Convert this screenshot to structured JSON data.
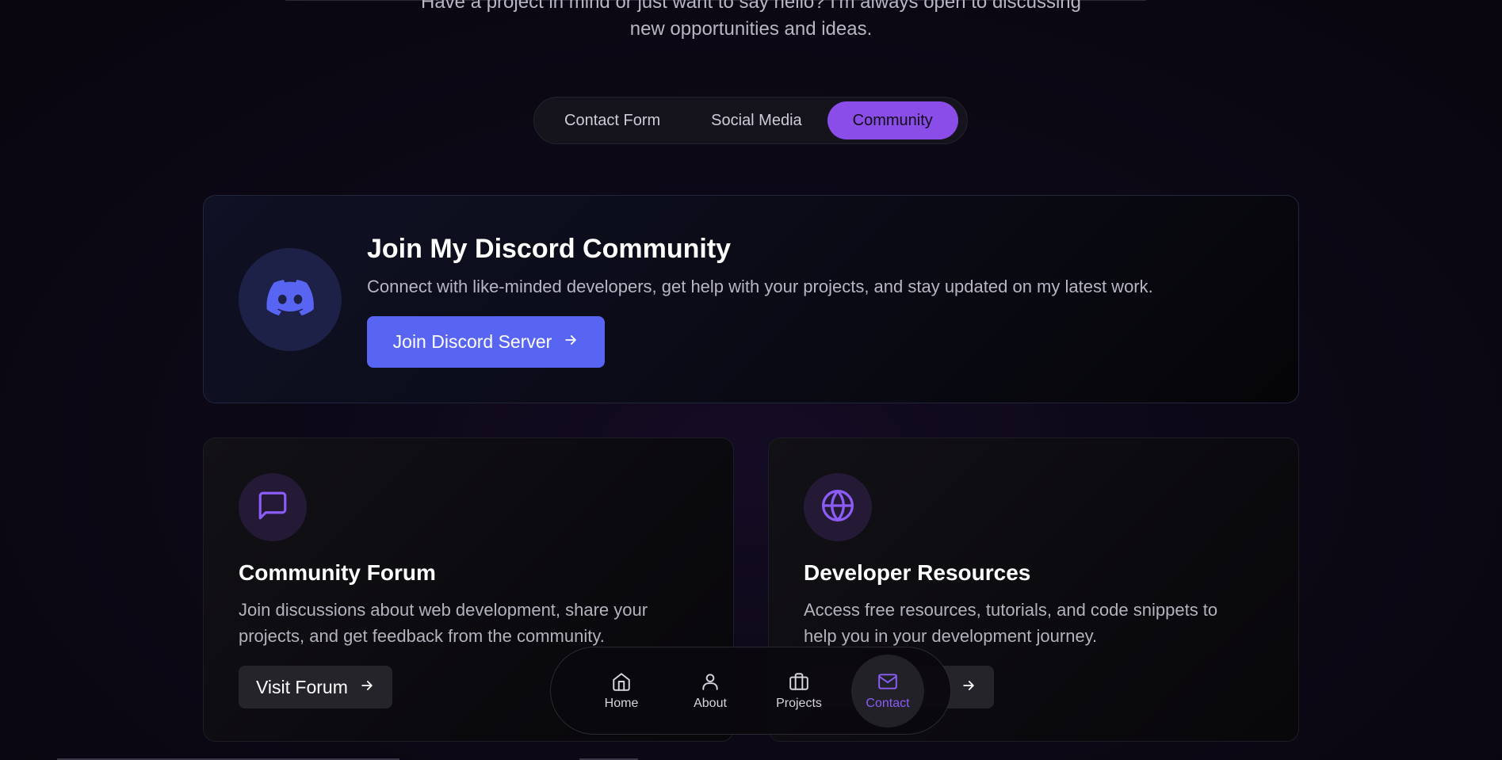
{
  "intro": {
    "line1": "Have a project in mind or just want to say hello? I'm always open to discussing",
    "line2": "new opportunities and ideas."
  },
  "tabs": [
    {
      "label": "Contact Form",
      "active": false
    },
    {
      "label": "Social Media",
      "active": false
    },
    {
      "label": "Community",
      "active": true
    }
  ],
  "discord": {
    "title": "Join My Discord Community",
    "description": "Connect with like-minded developers, get help with your projects, and stay updated on my latest work.",
    "button_label": "Join Discord Server",
    "icon": "discord-icon"
  },
  "cards": [
    {
      "title": "Community Forum",
      "description": "Join discussions about web development, share your projects, and get feedback from the community.",
      "button_label": "Visit Forum",
      "icon": "message-square-icon"
    },
    {
      "title": "Developer Resources",
      "description": "Access free resources, tutorials, and code snippets to help you in your development journey.",
      "button_label": "",
      "icon": "globe-icon"
    }
  ],
  "bottom_nav": [
    {
      "label": "Home",
      "icon": "home-icon",
      "active": false
    },
    {
      "label": "About",
      "icon": "user-icon",
      "active": false
    },
    {
      "label": "Projects",
      "icon": "briefcase-icon",
      "active": false
    },
    {
      "label": "Contact",
      "icon": "mail-icon",
      "active": true
    }
  ],
  "colors": {
    "accent": "#8b4de8",
    "discord": "#5865f2",
    "background": "#0c0816"
  }
}
